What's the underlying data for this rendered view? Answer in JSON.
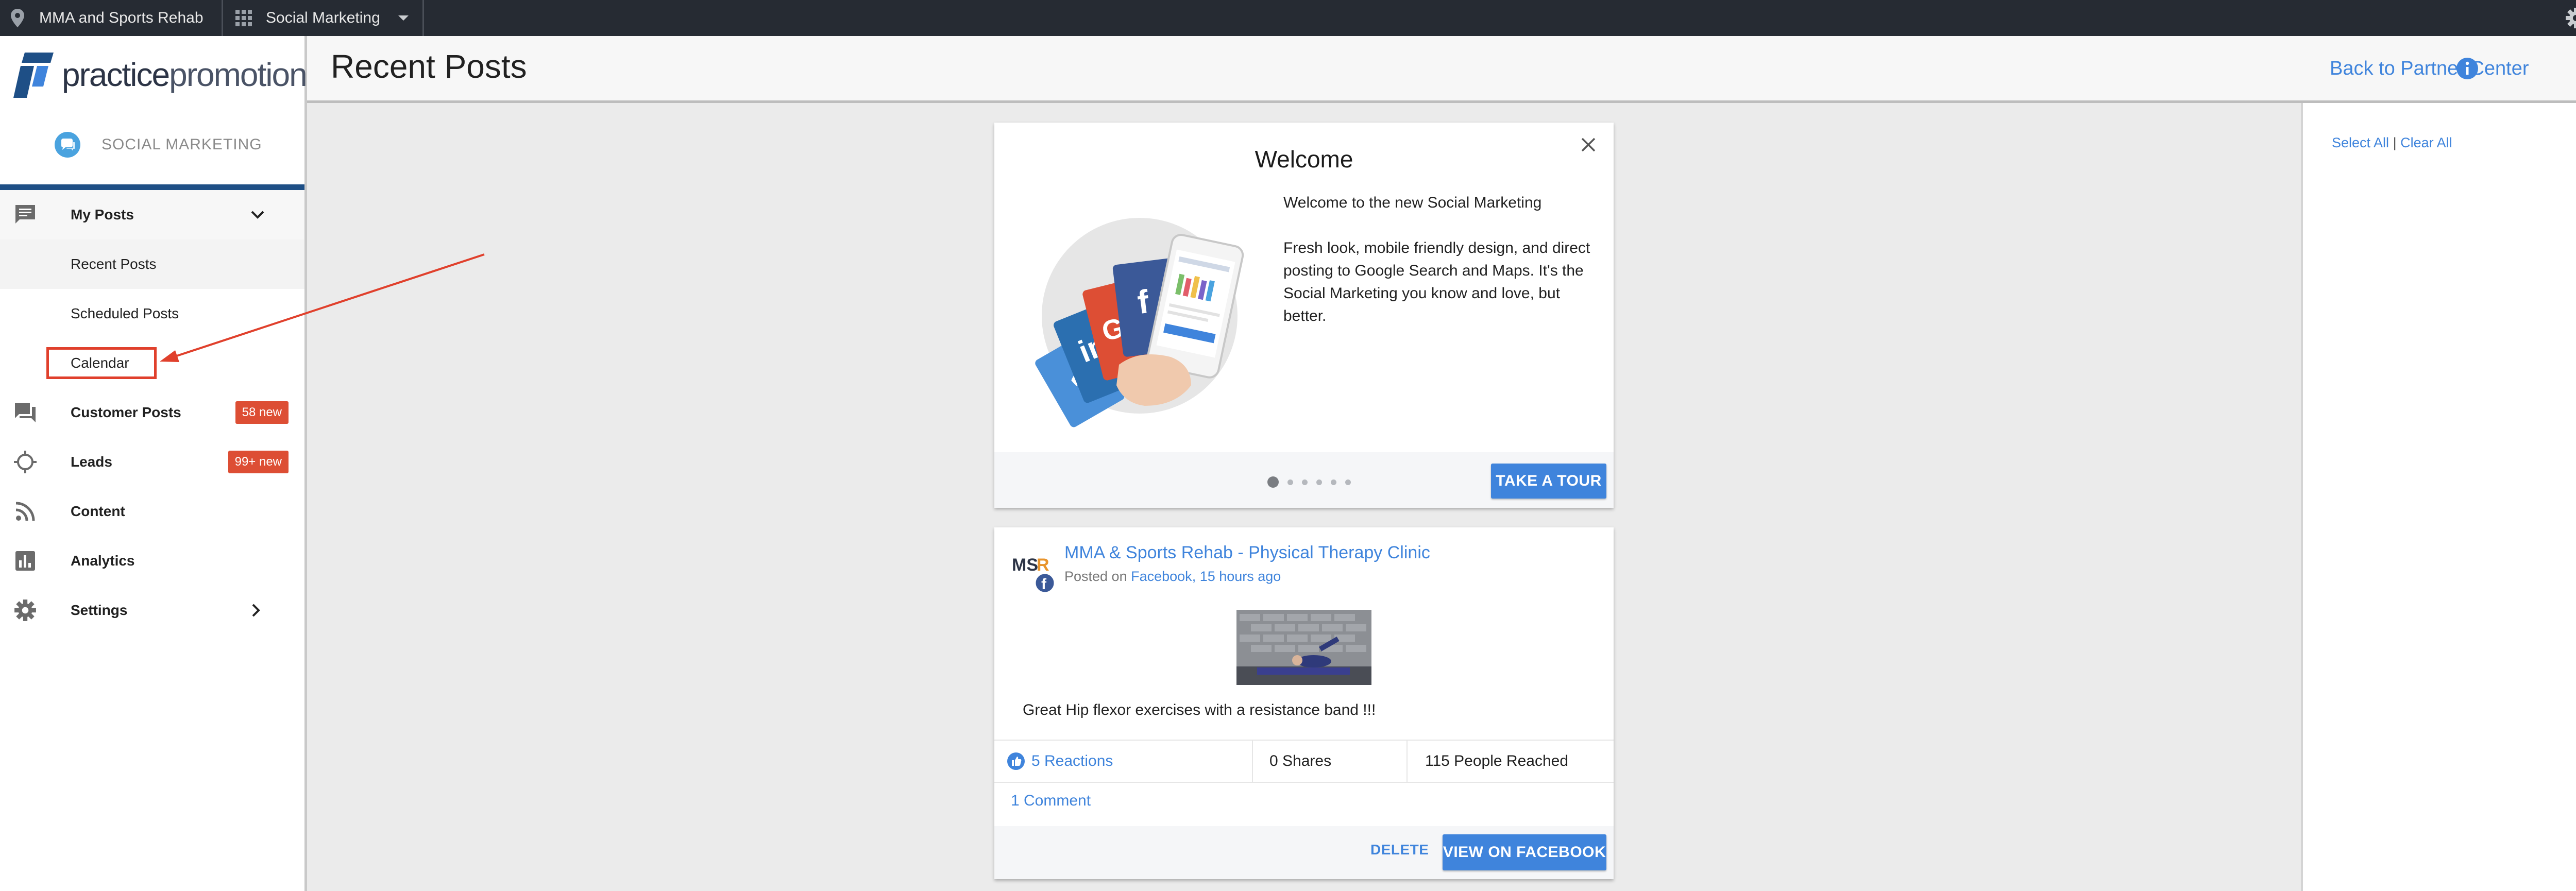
{
  "topbar": {
    "location_name": "MMA and Sports Rehab",
    "app_switcher_label": "Social Marketing"
  },
  "sidebar": {
    "logo_text_a": "practice",
    "logo_text_b": "promotions",
    "logo_tm": "™",
    "section_label": "SOCIAL MARKETING",
    "items": [
      {
        "label": "My Posts"
      },
      {
        "label": "Recent Posts"
      },
      {
        "label": "Scheduled Posts"
      },
      {
        "label": "Calendar"
      },
      {
        "label": "Customer Posts",
        "badge": "58 new"
      },
      {
        "label": "Leads",
        "badge": "99+ new"
      },
      {
        "label": "Content"
      },
      {
        "label": "Analytics"
      },
      {
        "label": "Settings"
      }
    ]
  },
  "header": {
    "title": "Recent Posts",
    "back_link": "Back to Partner Center"
  },
  "right_panel": {
    "select_all": "Select All",
    "separator": "|",
    "clear_all": "Clear All"
  },
  "welcome_card": {
    "title": "Welcome",
    "paragraph1": "Welcome to the new Social Marketing",
    "paragraph2": "Fresh look, mobile friendly design, and direct posting to Google Search and Maps. It's the Social Marketing you know and love, but better.",
    "carousel_active_index": 1,
    "carousel_count": 6,
    "button_label": "TAKE A TOUR"
  },
  "post_card": {
    "avatar_text": "MSR",
    "page_name": "MMA & Sports Rehab - Physical Therapy Clinic",
    "posted_on_prefix": "Posted on",
    "platform": "Facebook",
    "time_ago": "15 hours ago",
    "body": "Great Hip flexor exercises with a resistance band !!!",
    "reactions": "5 Reactions",
    "shares": "0 Shares",
    "reached": "115 People Reached",
    "comments": "1 Comment",
    "delete_label": "DELETE",
    "view_label": "VIEW ON FACEBOOK"
  },
  "colors": {
    "topbar_bg": "#262b33",
    "accent_blue": "#3f84dc",
    "badge_red": "#dd4e34",
    "sidebar_rule": "#1e4f86",
    "annotation_red": "#e0402c"
  }
}
